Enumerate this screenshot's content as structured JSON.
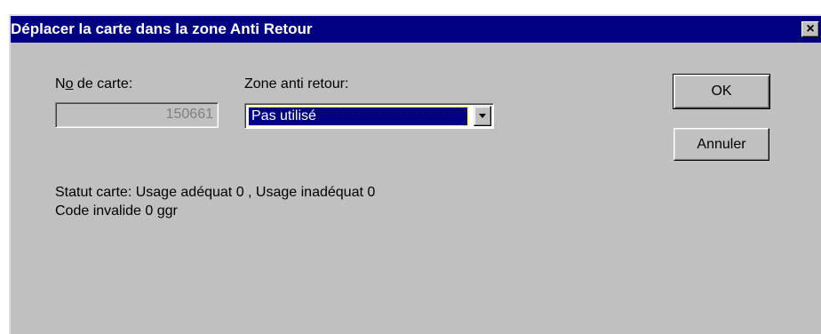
{
  "window": {
    "title": "Déplacer la carte dans la zone Anti Retour",
    "close_symbol": "×"
  },
  "card": {
    "label_prefix": "N",
    "label_accel": "o",
    "label_suffix": " de carte:",
    "value": "150661"
  },
  "zone": {
    "label": "Zone anti retour:",
    "selected": "Pas utilisé"
  },
  "buttons": {
    "ok": "OK",
    "cancel": "Annuler"
  },
  "status": {
    "line1": "Statut carte: Usage adéquat 0 , Usage inadéquat 0",
    "line2": "Code invalide 0 ggr"
  },
  "colors": {
    "titlebar": "#000080",
    "dialog_bg": "#c0c0c0",
    "selection": "#000080"
  },
  "icons": {
    "close": "close-icon",
    "dropdown": "chevron-down-icon"
  }
}
